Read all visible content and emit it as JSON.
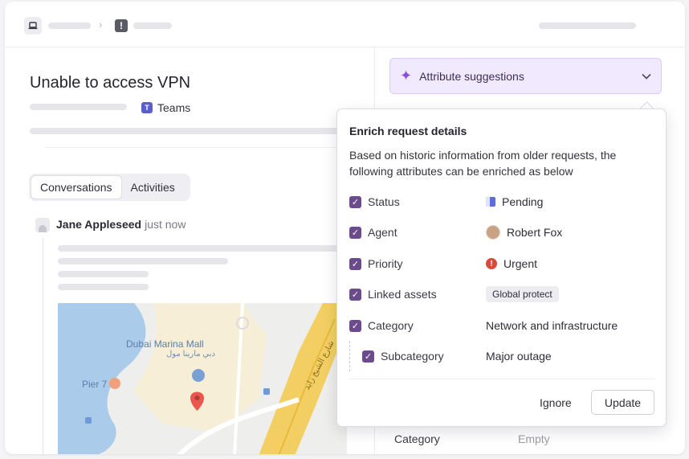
{
  "ticket": {
    "title": "Unable to access VPN",
    "source_label": "Teams"
  },
  "tabs": [
    {
      "label": "Conversations",
      "active": true
    },
    {
      "label": "Activities",
      "active": false
    }
  ],
  "message": {
    "author": "Jane Appleseed",
    "time": "just now"
  },
  "map": {
    "place_name": "Dubai Marina Mall",
    "place_name_ar": "دبي مارينا مول",
    "pier_label": "Pier 7",
    "road_label_ar": "شارع الشيخ زايد"
  },
  "sidebar": {
    "attr_suggestions_label": "Attribute suggestions",
    "category_label": "Category",
    "category_value": "Empty"
  },
  "enrich": {
    "title": "Enrich request details",
    "description": "Based on historic information from older requests, the following attributes can be enriched as below",
    "rows": [
      {
        "name": "Status",
        "value": "Pending",
        "checked": true
      },
      {
        "name": "Agent",
        "value": "Robert Fox",
        "checked": true
      },
      {
        "name": "Priority",
        "value": "Urgent",
        "checked": true
      },
      {
        "name": "Linked assets",
        "value": "Global protect",
        "checked": true
      },
      {
        "name": "Category",
        "value": "Network and infrastructure",
        "checked": true
      },
      {
        "name": "Subcategory",
        "value": "Major outage",
        "checked": true
      }
    ],
    "ignore_label": "Ignore",
    "update_label": "Update"
  },
  "colors": {
    "accent_purple": "#6b4a8e",
    "suggestion_bg": "#f1e9fd",
    "sparkle": "#8a4fe0",
    "pending": "#5a6fd8",
    "urgent": "#d84a3b",
    "teams": "#5b5fc7",
    "map_pin": "#e8584f"
  },
  "icons": {
    "breadcrumb_1": "laptop-icon",
    "breadcrumb_2": "alert-square-icon",
    "suggestions": "sparkle-icon",
    "dropdown": "chevron-down-icon"
  }
}
